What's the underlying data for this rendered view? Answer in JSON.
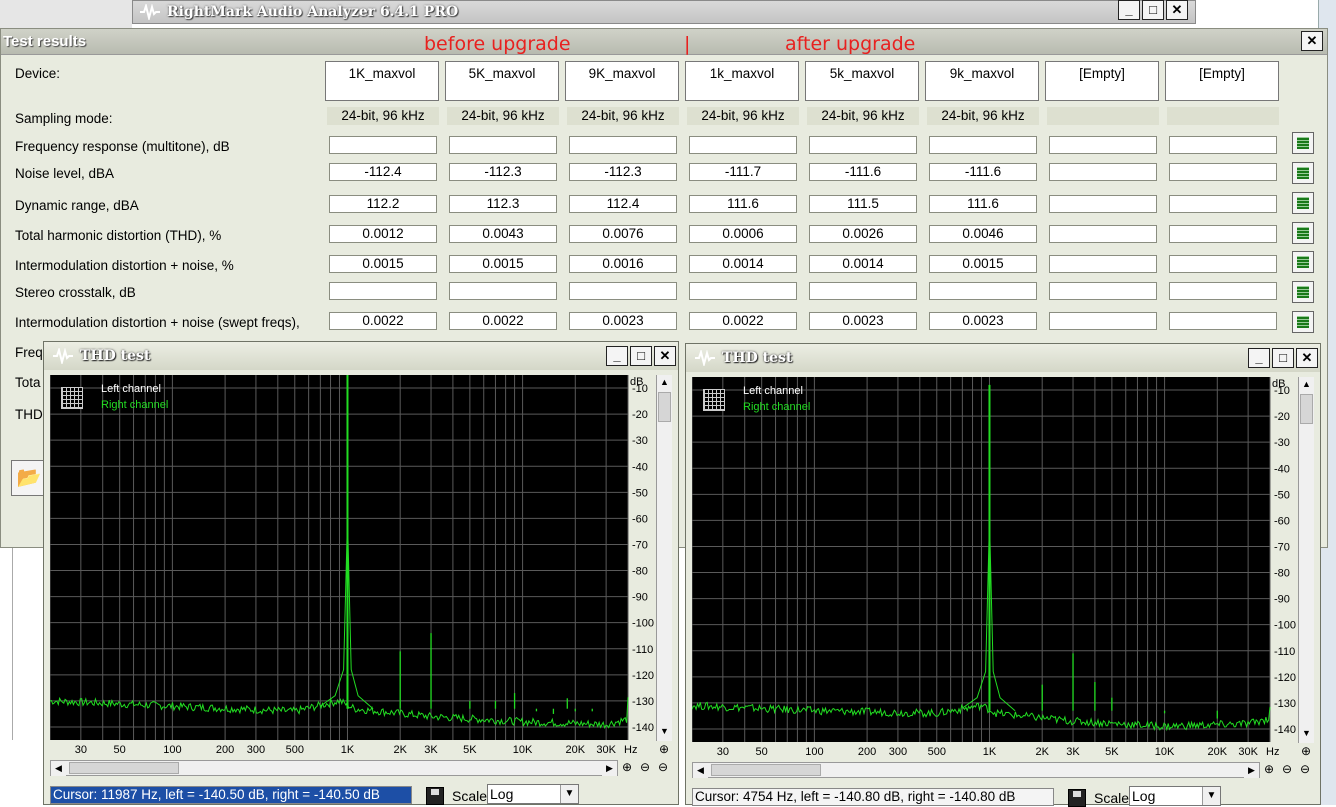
{
  "app": {
    "title": "RightMark Audio Analyzer 6.4.1 PRO"
  },
  "results": {
    "title": "Test results",
    "annotations": {
      "before": "before upgrade",
      "sep": "|",
      "after": "after upgrade"
    },
    "row_labels": {
      "device": "Device:",
      "sampling": "Sampling mode:",
      "freq_resp": "Frequency response (multitone), dB",
      "noise": "Noise level, dBA",
      "dyn": "Dynamic range, dBA",
      "thd": "Total harmonic distortion (THD), %",
      "imd": "Intermodulation distortion + noise, %",
      "crosstalk": "Stereo crosstalk, dB",
      "imd_swept": "Intermodulation distortion + noise (swept freqs),",
      "hidden1": "Freq",
      "hidden2": "Tota",
      "hidden3": "THD"
    },
    "devices": [
      "1K_maxvol",
      "5K_maxvol",
      "9K_maxvol",
      "1k_maxvol",
      "5k_maxvol",
      "9k_maxvol",
      "[Empty]",
      "[Empty]"
    ],
    "sampling": [
      "24-bit, 96 kHz",
      "24-bit, 96 kHz",
      "24-bit, 96 kHz",
      "24-bit, 96 kHz",
      "24-bit, 96 kHz",
      "24-bit, 96 kHz",
      "",
      ""
    ],
    "noise": [
      "-112.4",
      "-112.3",
      "-112.3",
      "-111.7",
      "-111.6",
      "-111.6",
      "",
      ""
    ],
    "dyn": [
      "112.2",
      "112.3",
      "112.4",
      "111.6",
      "111.5",
      "111.6",
      "",
      ""
    ],
    "thd": [
      "0.0012",
      "0.0043",
      "0.0076",
      "0.0006",
      "0.0026",
      "0.0046",
      "",
      ""
    ],
    "imd": [
      "0.0015",
      "0.0015",
      "0.0016",
      "0.0014",
      "0.0014",
      "0.0015",
      "",
      ""
    ],
    "imd_swept": [
      "0.0022",
      "0.0022",
      "0.0023",
      "0.0022",
      "0.0023",
      "0.0023",
      "",
      ""
    ]
  },
  "thd_left": {
    "title": "THD test",
    "legend": {
      "left": "Left channel",
      "right": "Right channel"
    },
    "cursor": "Cursor:  11987 Hz,  left = -140.50 dB,  right = -140.50 dB",
    "scale_label": "Scale",
    "scale_value": "Log"
  },
  "thd_right": {
    "title": "THD test",
    "legend": {
      "left": "Left channel",
      "right": "Right channel"
    },
    "cursor": "Cursor:  4754 Hz,  left = -140.80 dB,  right = -140.80 dB",
    "scale_label": "Scale",
    "scale_value": "Log"
  },
  "chart_data": [
    {
      "type": "line",
      "title": "",
      "xlabel": "Hz",
      "ylabel": "dB",
      "xscale": "log",
      "xlim": [
        20,
        40000
      ],
      "ylim": [
        -145,
        -5
      ],
      "grid": true,
      "xticks": [
        30,
        50,
        100,
        200,
        300,
        500,
        1000,
        2000,
        3000,
        5000,
        10000,
        20000,
        30000
      ],
      "xtick_labels": [
        "30",
        "50",
        "100",
        "200",
        "300",
        "500",
        "1K",
        "2K",
        "3K",
        "5K",
        "10K",
        "20K",
        "30K"
      ],
      "yticks": [
        -10,
        -20,
        -30,
        -40,
        -50,
        -60,
        -70,
        -80,
        -90,
        -100,
        -110,
        -120,
        -130,
        -140
      ],
      "series": [
        {
          "name": "Right channel",
          "color": "#22dd22"
        }
      ],
      "noise_floor": [
        [
          20,
          -130
        ],
        [
          100,
          -132
        ],
        [
          500,
          -134
        ],
        [
          900,
          -130
        ],
        [
          1100,
          -133
        ],
        [
          3000,
          -136
        ],
        [
          10000,
          -138
        ],
        [
          30000,
          -139
        ],
        [
          40000,
          -137
        ]
      ],
      "peaks": [
        [
          1000,
          -4
        ],
        [
          2000,
          -111
        ],
        [
          3000,
          -104
        ],
        [
          4000,
          -133
        ],
        [
          5000,
          -130
        ],
        [
          7000,
          -130
        ],
        [
          8000,
          -133
        ],
        [
          9000,
          -127
        ],
        [
          12000,
          -134
        ],
        [
          15000,
          -135
        ],
        [
          18000,
          -129
        ],
        [
          20000,
          -134
        ],
        [
          25000,
          -134
        ]
      ]
    },
    {
      "type": "line",
      "title": "",
      "xlabel": "Hz",
      "ylabel": "dB",
      "xscale": "log",
      "xlim": [
        20,
        40000
      ],
      "ylim": [
        -145,
        -5
      ],
      "grid": true,
      "xticks": [
        30,
        50,
        100,
        200,
        300,
        500,
        1000,
        2000,
        3000,
        5000,
        10000,
        20000,
        30000
      ],
      "xtick_labels": [
        "30",
        "50",
        "100",
        "200",
        "300",
        "500",
        "1K",
        "2K",
        "3K",
        "5K",
        "10K",
        "20K",
        "30K"
      ],
      "yticks": [
        -10,
        -20,
        -30,
        -40,
        -50,
        -60,
        -70,
        -80,
        -90,
        -100,
        -110,
        -120,
        -130,
        -140
      ],
      "series": [
        {
          "name": "Right channel",
          "color": "#22dd22"
        }
      ],
      "noise_floor": [
        [
          20,
          -131
        ],
        [
          100,
          -133
        ],
        [
          500,
          -134
        ],
        [
          900,
          -131
        ],
        [
          1100,
          -134
        ],
        [
          3000,
          -137
        ],
        [
          10000,
          -139
        ],
        [
          30000,
          -138
        ],
        [
          40000,
          -136
        ]
      ],
      "peaks": [
        [
          1000,
          -8
        ],
        [
          2000,
          -123
        ],
        [
          3000,
          -111
        ],
        [
          4000,
          -122
        ],
        [
          5000,
          -128
        ],
        [
          10000,
          -134
        ],
        [
          20000,
          -136
        ]
      ]
    }
  ]
}
